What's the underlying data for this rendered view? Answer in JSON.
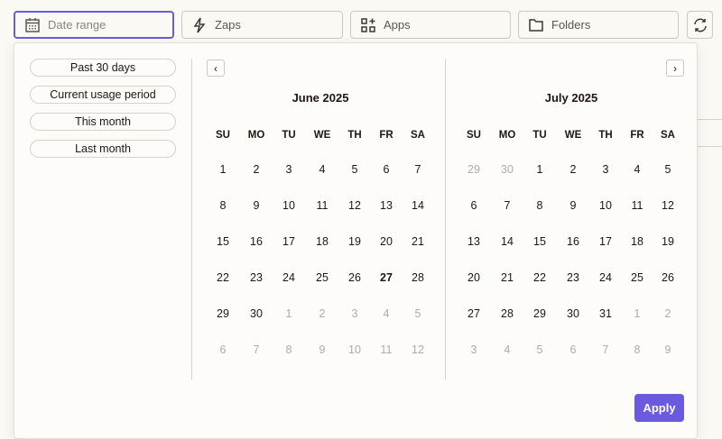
{
  "toolbar": {
    "date_range_placeholder": "Date range",
    "zaps": "Zaps",
    "apps": "Apps",
    "folders": "Folders"
  },
  "presets": [
    "Past 30 days",
    "Current usage period",
    "This month",
    "Last month"
  ],
  "weekdays": [
    "SU",
    "MO",
    "TU",
    "WE",
    "TH",
    "FR",
    "SA"
  ],
  "months": [
    {
      "title": "June 2025",
      "days": [
        [
          1,
          2,
          3,
          4,
          5,
          6,
          7
        ],
        [
          8,
          9,
          10,
          11,
          12,
          13,
          14
        ],
        [
          15,
          16,
          17,
          18,
          19,
          20,
          21
        ],
        [
          22,
          23,
          24,
          25,
          26,
          27,
          28
        ],
        [
          29,
          30,
          1,
          2,
          3,
          4,
          5
        ],
        [
          6,
          7,
          8,
          9,
          10,
          11,
          12
        ]
      ],
      "muted_from": [
        4,
        2
      ],
      "today": [
        3,
        5
      ]
    },
    {
      "title": "July 2025",
      "days": [
        [
          29,
          30,
          1,
          2,
          3,
          4,
          5
        ],
        [
          6,
          7,
          8,
          9,
          10,
          11,
          12
        ],
        [
          13,
          14,
          15,
          16,
          17,
          18,
          19
        ],
        [
          20,
          21,
          22,
          23,
          24,
          25,
          26
        ],
        [
          27,
          28,
          29,
          30,
          31,
          1,
          2
        ],
        [
          3,
          4,
          5,
          6,
          7,
          8,
          9
        ]
      ],
      "muted_leading": 2,
      "muted_from": [
        4,
        5
      ]
    }
  ],
  "apply_label": "Apply",
  "colors": {
    "accent": "#6a5ae0"
  }
}
